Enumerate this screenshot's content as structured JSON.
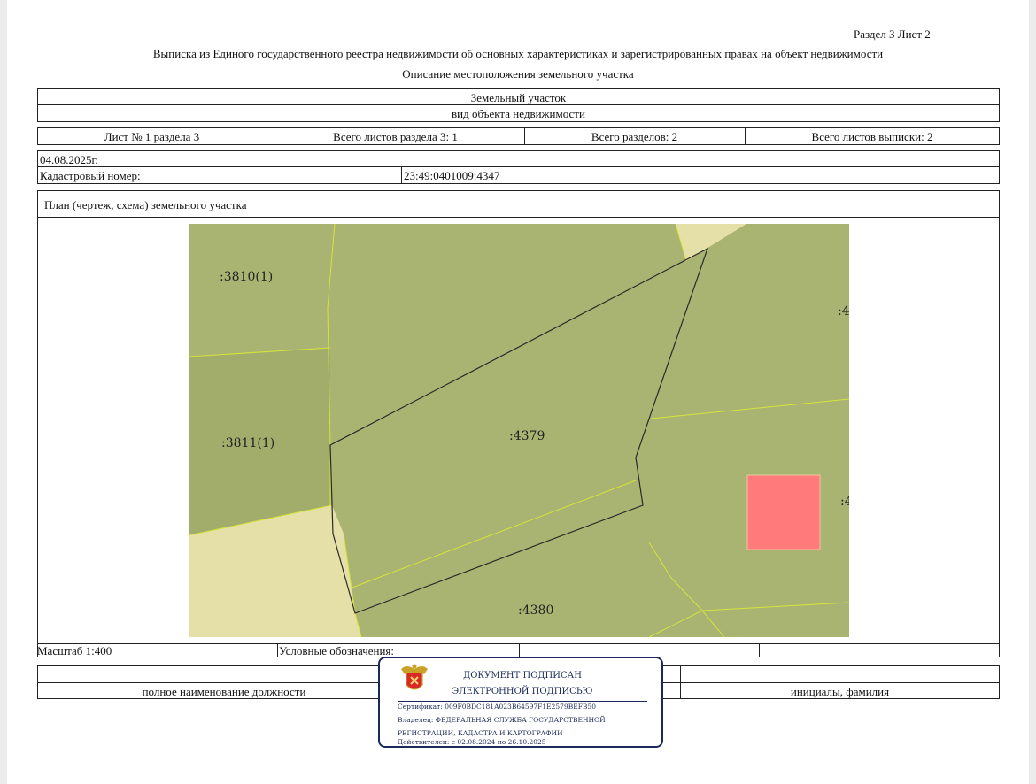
{
  "header": {
    "section_sheet": "Раздел 3    Лист 2",
    "title": "Выписка из Единого государственного реестра недвижимости об основных характеристиках и зарегистрированных правах на объект недвижимости",
    "subtitle": "Описание местоположения земельного участка"
  },
  "object": {
    "type_value": "Земельный участок",
    "type_label": "вид объекта недвижимости"
  },
  "sheets": {
    "sheet_of_section": "Лист № 1 раздела 3",
    "total_section_sheets": "Всего листов раздела 3: 1",
    "total_sections": "Всего разделов: 2",
    "total_extract_sheets": "Всего листов выписки: 2"
  },
  "info": {
    "date": "04.08.2025г.",
    "cadastral_label": "Кадастровый номер:",
    "cadastral_value": "23:49:0401009:4347"
  },
  "plan": {
    "title": "План (чертеж, схема) земельного участка",
    "labels": {
      "p3810": ":3810(1)",
      "p3811": ":3811(1)",
      "p4379": ":4379",
      "p4380": ":4380",
      "edge1": ":4",
      "edge2": ":4"
    },
    "colors": {
      "parcel": "#a9b472",
      "parcel_dark": "#a2ad6c",
      "free": "#e5e0a8",
      "highlight": "#ff7b7b",
      "boundary": "#d6e43a"
    }
  },
  "footer": {
    "scale": "Масштаб 1:400",
    "legend": "Условные обозначения:",
    "position_label": "полное наименование должности",
    "initials_label": "инициалы, фамилия"
  },
  "stamp": {
    "line1": "ДОКУМЕНТ ПОДПИСАН",
    "line2": "ЭЛЕКТРОННОЙ ПОДПИСЬЮ",
    "certificate": "Сертификат: 009F0BDC181A023B64597F1E2579BEFB50",
    "owner1": "Владелец: ФЕДЕРАЛЬНАЯ СЛУЖБА ГОСУДАРСТВЕННОЙ",
    "owner2": "РЕГИСТРАЦИИ, КАДАСТРА И КАРТОГРАФИИ",
    "valid": "Действителен: с 02.08.2024 по 26.10.2025",
    "emblem_icon": "coat-of-arms-icon"
  }
}
